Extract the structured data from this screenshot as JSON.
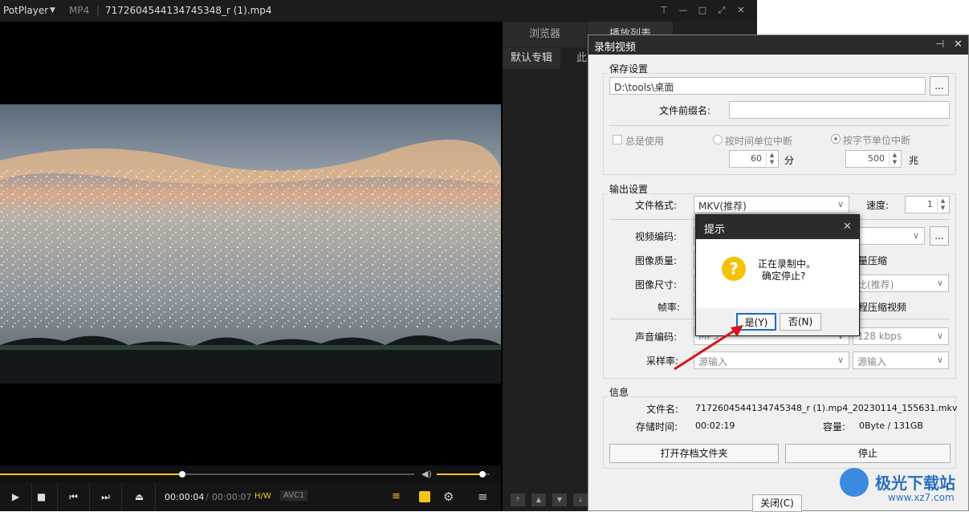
{
  "app": {
    "name": "PotPlayer",
    "format": "MP4",
    "file": "7172604544134745348_r (1).mp4"
  },
  "side_panel": {
    "tabs": [
      "浏览器",
      "播放列表"
    ],
    "subtabs": [
      "默认专辑",
      "此"
    ]
  },
  "controls": {
    "time_current": "00:00:04",
    "time_sep": "/",
    "time_total": "00:00:07",
    "hw": "H/W",
    "codec": "AVC1",
    "progress": 0.44,
    "volume": 0.86
  },
  "record": {
    "title": "录制视频",
    "save": {
      "label": "保存设置",
      "path": "D:\\tools\\桌面",
      "browse": "...",
      "prefix_label": "文件前缀名:",
      "prefix_value": "",
      "always_use": "总是使用",
      "by_time": "按时间单位中断",
      "by_size": "按字节单位中断",
      "minutes": "60",
      "min_unit": "分",
      "megabytes": "500",
      "mb_unit": "兆"
    },
    "output": {
      "label": "输出设置",
      "format_label": "文件格式:",
      "format_value": "MKV(推荐)",
      "speed_label": "速度:",
      "speed_value": "1",
      "vcodec_label": "视频编码:",
      "quality_label": "图像质量:",
      "quality_right": "量压缩",
      "size_label": "图像尺寸:",
      "size_right": "比(推荐)",
      "fps_label": "帧率:",
      "fps_right": "程压缩视频",
      "acodec_label": "声音编码:",
      "acodec_value": "MP3",
      "bitrate_value": "128 kbps",
      "samplerate_label": "采样率:",
      "samplerate_value": "源输入",
      "channels_value": "源输入"
    },
    "info": {
      "label": "信息",
      "filename_label": "文件名:",
      "filename_value": "7172604544134745348_r (1).mp4_20230114_155631.mkv",
      "time_label": "存储时间:",
      "time_value": "00:02:19",
      "capacity_label": "容量:",
      "capacity_value": "0Byte / 131GB"
    },
    "open_folder": "打开存档文件夹",
    "stop": "停止",
    "close": "关闭(C)"
  },
  "prompt": {
    "title": "提示",
    "line1": "正在录制中。",
    "line2": "确定停止?",
    "yes": "是(Y)",
    "no": "否(N)"
  },
  "watermark": {
    "name": "极光下载站",
    "url": "www.xz7.com"
  },
  "colors": {
    "accent": "#f5c518",
    "arrow": "#d9141c"
  }
}
